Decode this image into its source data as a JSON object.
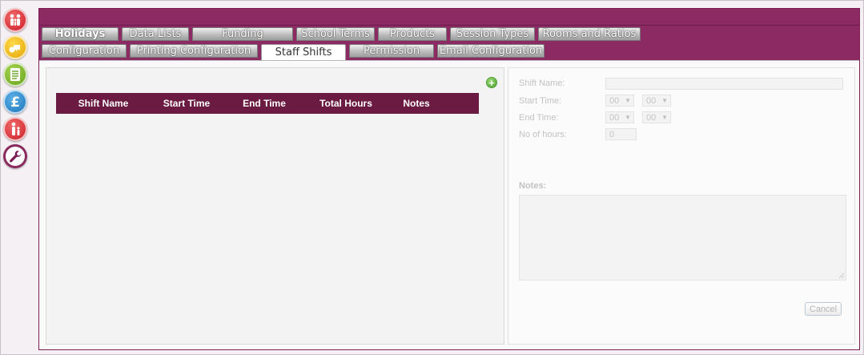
{
  "rail": {
    "icons": [
      "family-icon",
      "chat-icon",
      "document-list-icon",
      "pound-icon",
      "people-icon",
      "wrench-icon"
    ]
  },
  "tabs": {
    "row1": [
      "Holidays",
      "Data Lists",
      "Funding",
      "School Terms",
      "Products",
      "Session Types",
      "Rooms and Ratios"
    ],
    "row2": [
      "Configuration",
      "Printing Configuration",
      "Staff Shifts",
      "Permission",
      "Email Configuration"
    ],
    "active": "Staff Shifts"
  },
  "table": {
    "columns": [
      "Shift Name",
      "Start Time",
      "End Time",
      "Total Hours",
      "Notes"
    ],
    "rows": []
  },
  "form": {
    "shift_name_label": "Shift Name:",
    "shift_name_value": "",
    "start_time_label": "Start Time:",
    "start_hour": "00",
    "start_minute": "00",
    "end_time_label": "End Time:",
    "end_hour": "00",
    "end_minute": "00",
    "hours_label": "No of hours:",
    "hours_value": "0",
    "notes_label": "Notes:",
    "notes_value": "",
    "cancel_label": "Cancel"
  },
  "colors": {
    "header_bar": "#8c2a63",
    "table_header": "#6b1a41",
    "add_button": "#3e9a1f"
  }
}
